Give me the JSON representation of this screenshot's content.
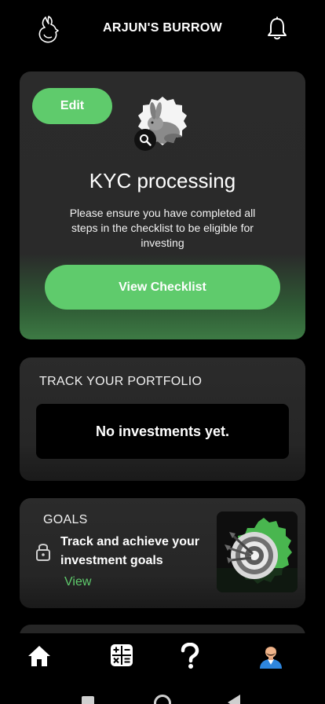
{
  "header": {
    "title": "ARJUN'S BURROW",
    "logo_icon": "rabbit-logo-icon",
    "notifications_icon": "bell-icon"
  },
  "kyc": {
    "edit_label": "Edit",
    "title": "KYC processing",
    "description": "Please ensure you have completed all steps in the checklist to be eligible for investing",
    "button_label": "View Checklist",
    "avatar_icon": "rabbit-avatar",
    "zoom_icon": "search-icon"
  },
  "portfolio": {
    "title": "TRACK YOUR PORTFOLIO",
    "empty_text": "No investments yet."
  },
  "goals": {
    "title": "GOALS",
    "text": "Track and achieve your investment goals",
    "view_label": "View",
    "lock_icon": "lock-icon",
    "image_icon": "target-dartboard-icon"
  },
  "nav": {
    "items": [
      {
        "icon": "home-icon"
      },
      {
        "icon": "calculator-icon"
      },
      {
        "icon": "help-icon"
      },
      {
        "icon": "profile-avatar-icon"
      }
    ]
  },
  "colors": {
    "accent": "#5fcb6c",
    "card": "#2b2b2b",
    "background": "#000000"
  }
}
